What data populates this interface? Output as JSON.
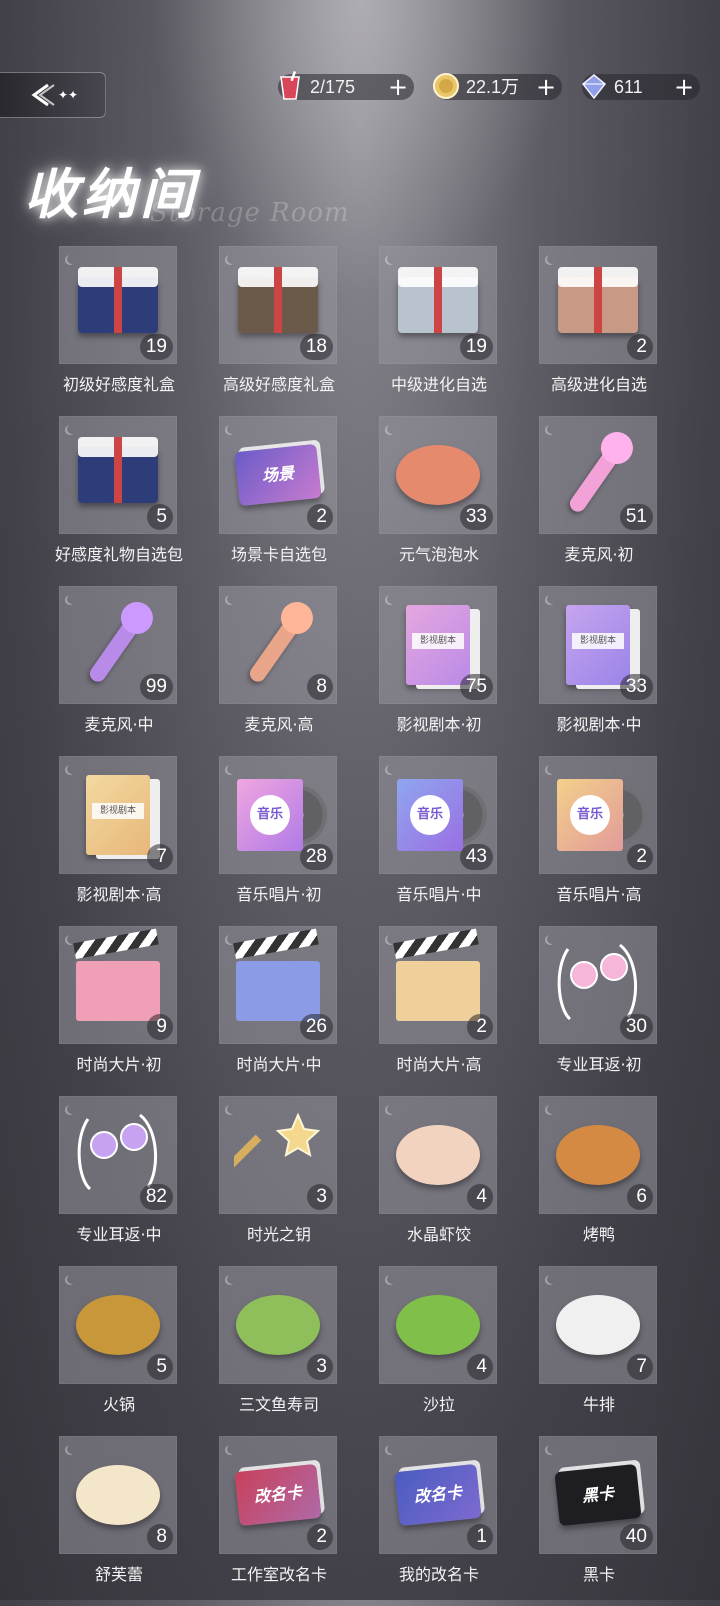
{
  "header": {
    "title": "收纳间",
    "subtitle": "Storage Room",
    "resources": [
      {
        "name": "energy",
        "icon": "drink-icon",
        "value": "2/175",
        "plus": "+"
      },
      {
        "name": "gold",
        "icon": "gold-coin-icon",
        "value": "22.1万",
        "plus": "+"
      },
      {
        "name": "diamond",
        "icon": "diamond-icon",
        "value": "611",
        "plus": "+"
      }
    ]
  },
  "items": [
    {
      "name": "初级好感度礼盒",
      "count": "19"
    },
    {
      "name": "高级好感度礼盒",
      "count": "18"
    },
    {
      "name": "中级进化自选",
      "count": "19"
    },
    {
      "name": "高级进化自选",
      "count": "2"
    },
    {
      "name": "好感度礼物自选包",
      "count": "5"
    },
    {
      "name": "场景卡自选包",
      "count": "2"
    },
    {
      "name": "元气泡泡水",
      "count": "33"
    },
    {
      "name": "麦克风·初",
      "count": "51"
    },
    {
      "name": "麦克风·中",
      "count": "99"
    },
    {
      "name": "麦克风·高",
      "count": "8"
    },
    {
      "name": "影视剧本·初",
      "count": "75"
    },
    {
      "name": "影视剧本·中",
      "count": "33"
    },
    {
      "name": "影视剧本·高",
      "count": "7"
    },
    {
      "name": "音乐唱片·初",
      "count": "28"
    },
    {
      "name": "音乐唱片·中",
      "count": "43"
    },
    {
      "name": "音乐唱片·高",
      "count": "2"
    },
    {
      "name": "时尚大片·初",
      "count": "9"
    },
    {
      "name": "时尚大片·中",
      "count": "26"
    },
    {
      "name": "时尚大片·高",
      "count": "2"
    },
    {
      "name": "专业耳返·初",
      "count": "30"
    },
    {
      "name": "专业耳返·中",
      "count": "82"
    },
    {
      "name": "时光之钥",
      "count": "3"
    },
    {
      "name": "水晶虾饺",
      "count": "4"
    },
    {
      "name": "烤鸭",
      "count": "6"
    },
    {
      "name": "火锅",
      "count": "5"
    },
    {
      "name": "三文鱼寿司",
      "count": "3"
    },
    {
      "name": "沙拉",
      "count": "4"
    },
    {
      "name": "牛排",
      "count": "7"
    },
    {
      "name": "舒芙蕾",
      "count": "8"
    },
    {
      "name": "工作室改名卡",
      "count": "2"
    },
    {
      "name": "我的改名卡",
      "count": "1"
    },
    {
      "name": "黑卡",
      "count": "40"
    }
  ],
  "art_labels": {
    "script": "影视剧本",
    "music": "音乐",
    "scene": "场景",
    "rename": "改名卡",
    "black": "黑卡"
  }
}
